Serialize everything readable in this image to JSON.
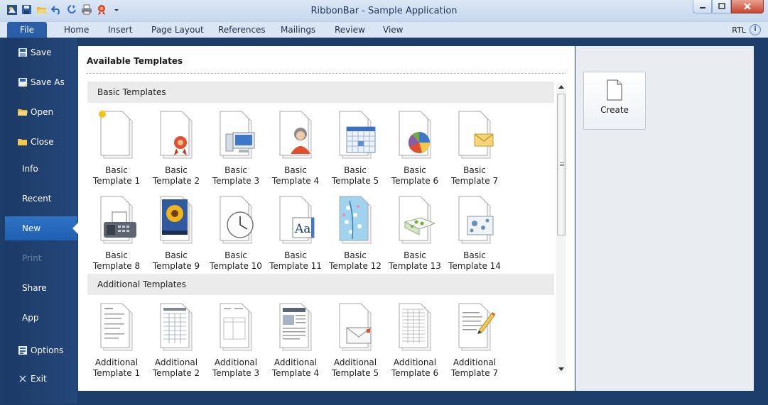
{
  "window": {
    "title": "RibbonBar - Sample Application",
    "controls": [
      "minimize-icon",
      "maximize-icon",
      "close-icon"
    ]
  },
  "quick_access": [
    "app-logo-icon",
    "save-icon",
    "open-folder-icon",
    "undo-icon",
    "redo-icon",
    "print-icon",
    "ribbon-award-icon",
    "dropdown-icon"
  ],
  "ribbon": {
    "file_tab": "File",
    "tabs": [
      "Home",
      "Insert",
      "Page Layout",
      "References",
      "Mailings",
      "Review",
      "View"
    ],
    "rtl_label": "RTL",
    "help_glyph": "i"
  },
  "nav": {
    "items": [
      {
        "label": "Save",
        "icon": "save-icon",
        "state": "normal"
      },
      {
        "label": "Save As",
        "icon": "save-as-icon",
        "state": "normal"
      },
      {
        "label": "Open",
        "icon": "open-folder-icon",
        "state": "normal"
      },
      {
        "label": "Close",
        "icon": "close-folder-icon",
        "state": "normal"
      },
      {
        "label": "Info",
        "icon": "",
        "state": "normal"
      },
      {
        "label": "Recent",
        "icon": "",
        "state": "normal"
      },
      {
        "label": "New",
        "icon": "",
        "state": "selected"
      },
      {
        "label": "Print",
        "icon": "",
        "state": "disabled"
      },
      {
        "label": "Share",
        "icon": "",
        "state": "normal"
      },
      {
        "label": "App",
        "icon": "",
        "state": "normal"
      },
      {
        "label": "Options",
        "icon": "options-icon",
        "state": "normal"
      },
      {
        "label": "Exit",
        "icon": "exit-icon",
        "state": "normal"
      }
    ]
  },
  "main": {
    "title": "Available Templates",
    "sections": [
      {
        "header": "Basic Templates",
        "templates": [
          {
            "label": "Basic\nTemplate 1",
            "icon": "blank-document-icon"
          },
          {
            "label": "Basic\nTemplate 2",
            "icon": "award-document-icon"
          },
          {
            "label": "Basic\nTemplate 3",
            "icon": "computer-document-icon"
          },
          {
            "label": "Basic\nTemplate 4",
            "icon": "user-document-icon"
          },
          {
            "label": "Basic\nTemplate 5",
            "icon": "calendar-document-icon"
          },
          {
            "label": "Basic\nTemplate 6",
            "icon": "pie-chart-document-icon"
          },
          {
            "label": "Basic\nTemplate 7",
            "icon": "envelope-document-icon"
          },
          {
            "label": "Basic\nTemplate 8",
            "icon": "fax-document-icon"
          },
          {
            "label": "Basic\nTemplate 9",
            "icon": "photo-document-icon"
          },
          {
            "label": "Basic\nTemplate 10",
            "icon": "clock-document-icon"
          },
          {
            "label": "Basic\nTemplate 11",
            "icon": "font-document-icon"
          },
          {
            "label": "Basic\nTemplate 12",
            "icon": "floral-document-icon"
          },
          {
            "label": "Basic\nTemplate 13",
            "icon": "card-document-icon"
          },
          {
            "label": "Basic\nTemplate 14",
            "icon": "postcard-document-icon"
          }
        ]
      },
      {
        "header": "Additional Templates",
        "templates": [
          {
            "label": "Additional\nTemplate 1",
            "icon": "resume-document-icon"
          },
          {
            "label": "Additional\nTemplate 2",
            "icon": "timesheet-document-icon"
          },
          {
            "label": "Additional\nTemplate 3",
            "icon": "invoice-document-icon"
          },
          {
            "label": "Additional\nTemplate 4",
            "icon": "newsletter-document-icon"
          },
          {
            "label": "Additional\nTemplate 5",
            "icon": "mail-document-icon"
          },
          {
            "label": "Additional\nTemplate 6",
            "icon": "spreadsheet-document-icon"
          },
          {
            "label": "Additional\nTemplate 7",
            "icon": "letter-pencil-document-icon"
          }
        ]
      }
    ]
  },
  "side": {
    "create_label": "Create",
    "create_icon": "new-document-icon"
  },
  "colors": {
    "nav_bg": "#1d3e6b",
    "nav_selected": "#2a6bbd",
    "file_tab": "#2a5ea9",
    "section_header_bg": "#ebebeb",
    "right_panel_bg": "#e9edf2"
  }
}
